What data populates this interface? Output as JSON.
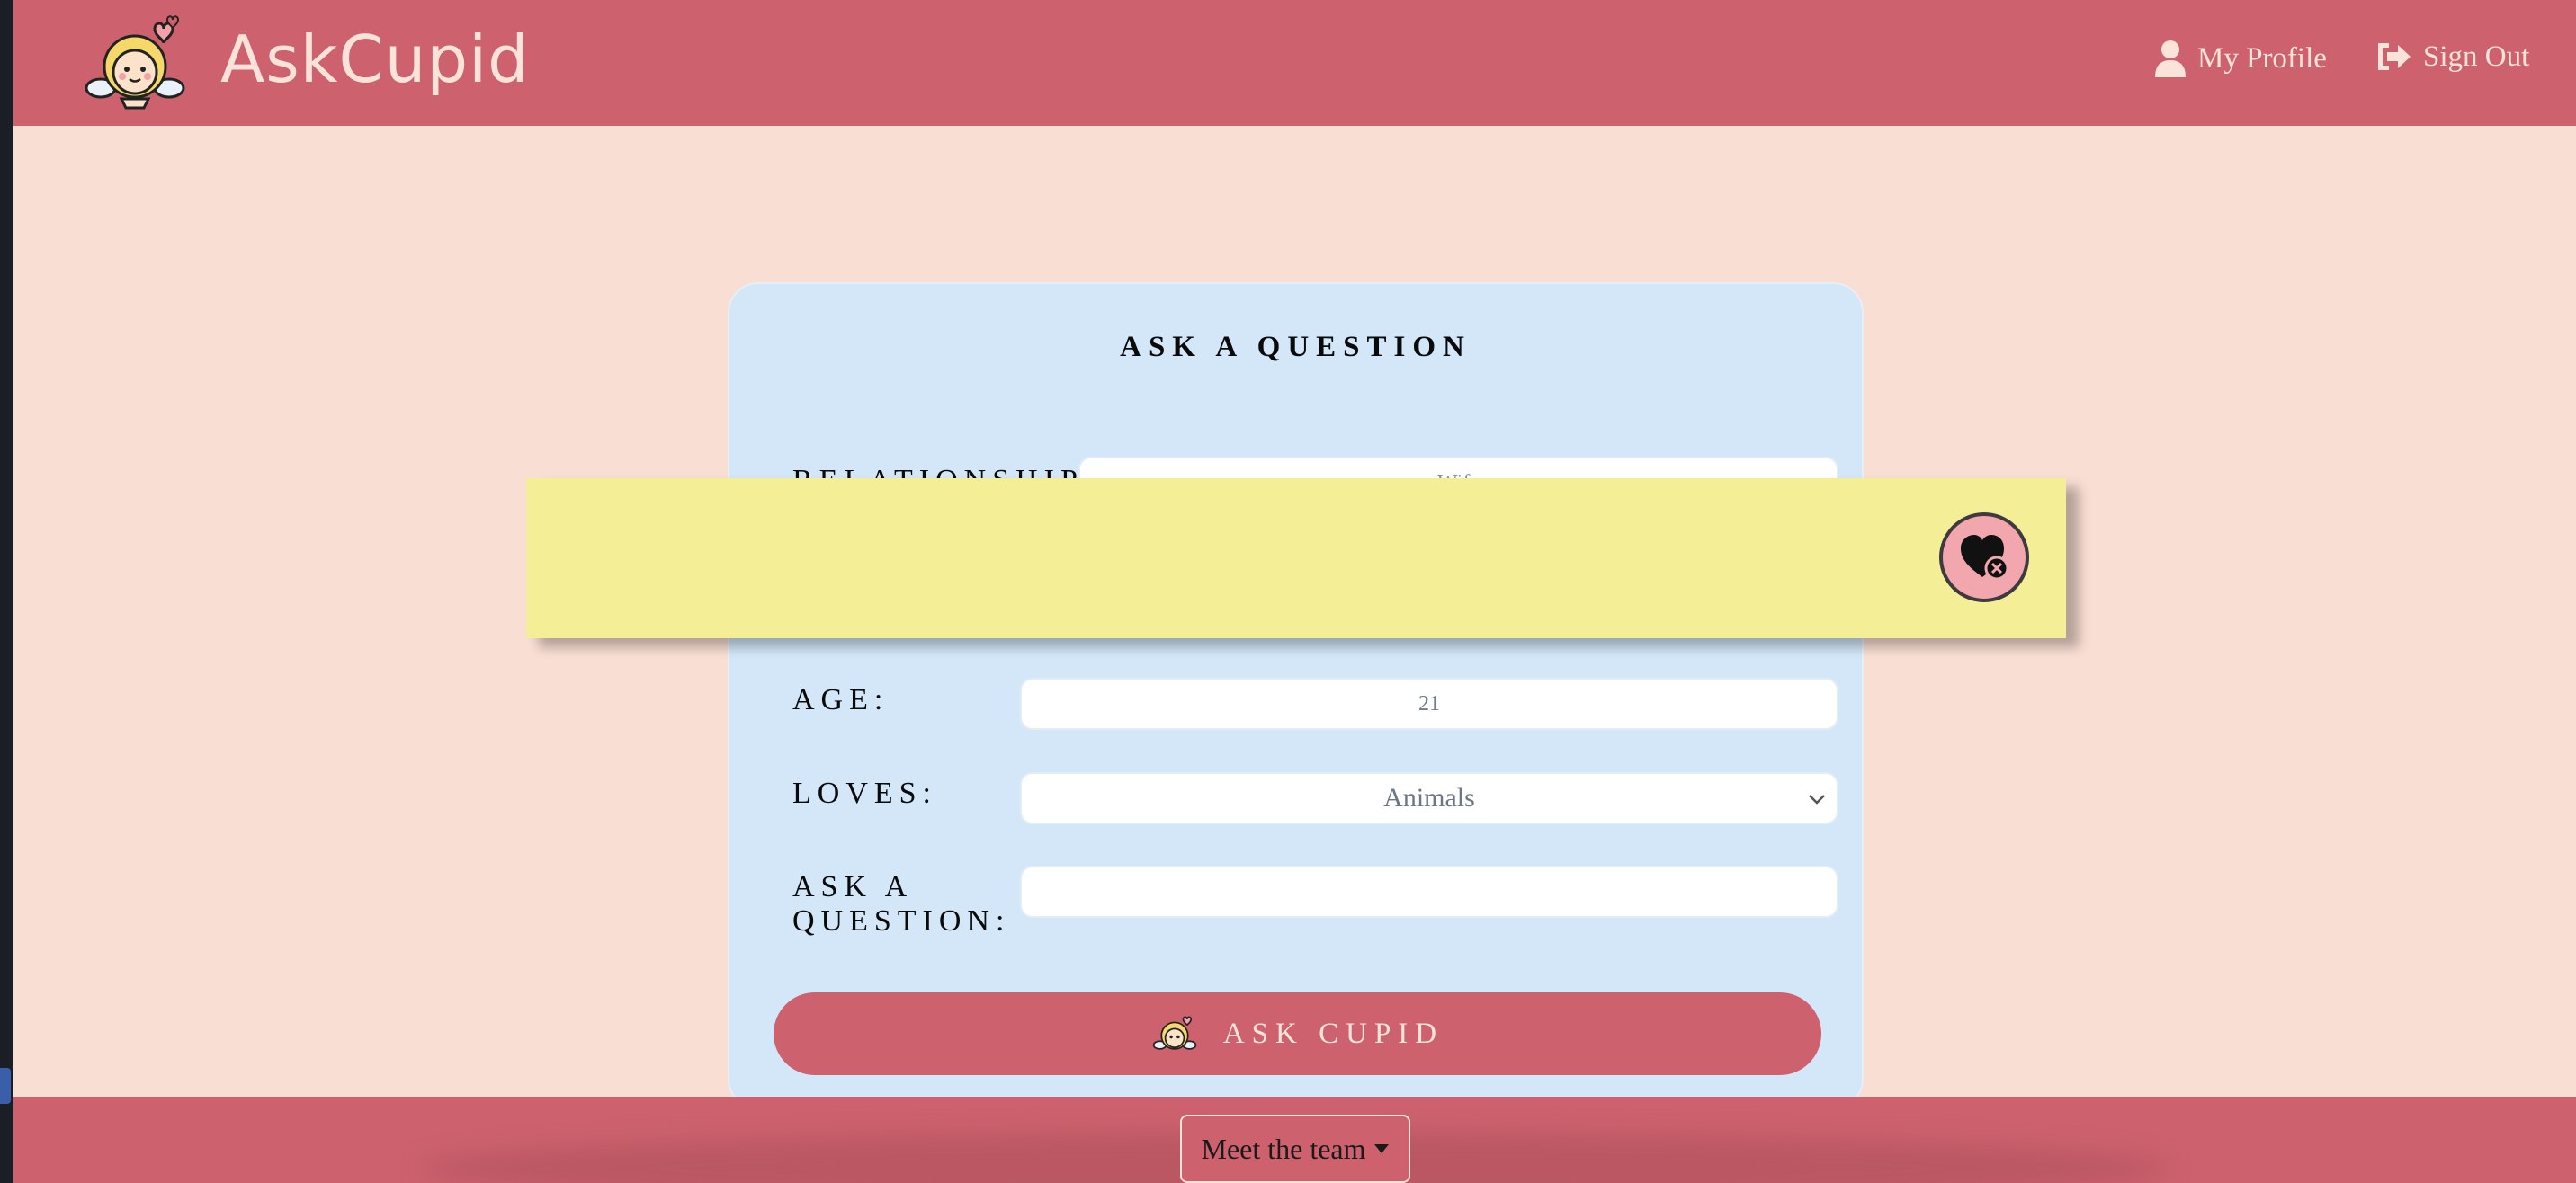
{
  "navbar": {
    "brand": "AskCupid",
    "profile_label": "My Profile",
    "signout_label": "Sign Out"
  },
  "form": {
    "title": "ASK A QUESTION",
    "relationship_label": "RELATIONSHIP",
    "relationship_value": "Wife",
    "age_label": "AGE:",
    "age_value": "21",
    "loves_label": "LOVES:",
    "loves_selected": "Animals",
    "question_label_line1": "ASK A",
    "question_label_line2": "QUESTION:",
    "question_value": "",
    "submit_label": "ASK CUPID"
  },
  "footer": {
    "team_button_label": "Meet the team"
  },
  "colors": {
    "primary": "#cd626e",
    "background": "#f9ded3",
    "card": "#d3e7f8",
    "banner": "#f4ee96",
    "close_button": "#f2a6ad"
  },
  "icons": {
    "logo": "cupid-logo-icon",
    "profile": "user-icon",
    "signout": "sign-out-icon",
    "banner_close": "heart-close-icon",
    "select": "chevron-down-icon",
    "dropdown": "caret-down-icon"
  }
}
